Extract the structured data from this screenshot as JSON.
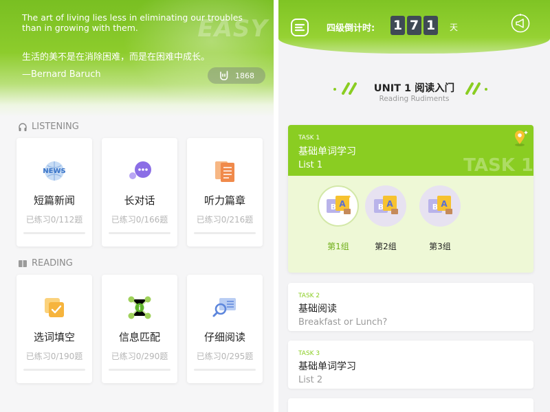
{
  "left": {
    "quote": {
      "english": "The art of living lies less in eliminating our troubles than in growing with them.",
      "chinese": "生活的美不是在消除困难，而是在困难中成长。",
      "author": "—Bernard Baruch",
      "watermark": "EASY",
      "likes": "1868"
    },
    "listening": {
      "label": "LISTENING",
      "cards": [
        {
          "title": "短篇新闻",
          "count": "已练习0/112题",
          "icon": "news-icon"
        },
        {
          "title": "长对话",
          "count": "已练习0/166题",
          "icon": "chat-bubble-icon"
        },
        {
          "title": "听力篇章",
          "count": "已练习0/216题",
          "icon": "document-icon"
        }
      ]
    },
    "reading": {
      "label": "READING",
      "cards": [
        {
          "title": "选词填空",
          "count": "已练习0/190题",
          "icon": "checkbox-icon"
        },
        {
          "title": "信息匹配",
          "count": "已练习0/290题",
          "icon": "network-icon"
        },
        {
          "title": "仔细阅读",
          "count": "已练习0/295题",
          "icon": "magnifier-icon"
        }
      ]
    }
  },
  "right": {
    "countdown": {
      "label": "四级倒计时:",
      "digits": [
        "1",
        "7",
        "1"
      ],
      "unit": "天"
    },
    "unit": {
      "title": "UNIT 1 阅读入门",
      "subtitle": "Reading Rudiments"
    },
    "task1": {
      "label": "TASK 1",
      "name": "基础单词学习",
      "list": "List 1",
      "watermark": "TASK 1",
      "groups": [
        "第1组",
        "第2组",
        "第3组"
      ]
    },
    "task2": {
      "label": "TASK 2",
      "name": "基础阅读",
      "sub": "Breakfast or Lunch?"
    },
    "task3": {
      "label": "TASK 3",
      "name": "基础单词学习",
      "sub": "List 2"
    }
  },
  "colors": {
    "brand_green": "#8acd22",
    "countdown_tile": "#3f4a55",
    "active_group_text": "#6fae18"
  }
}
